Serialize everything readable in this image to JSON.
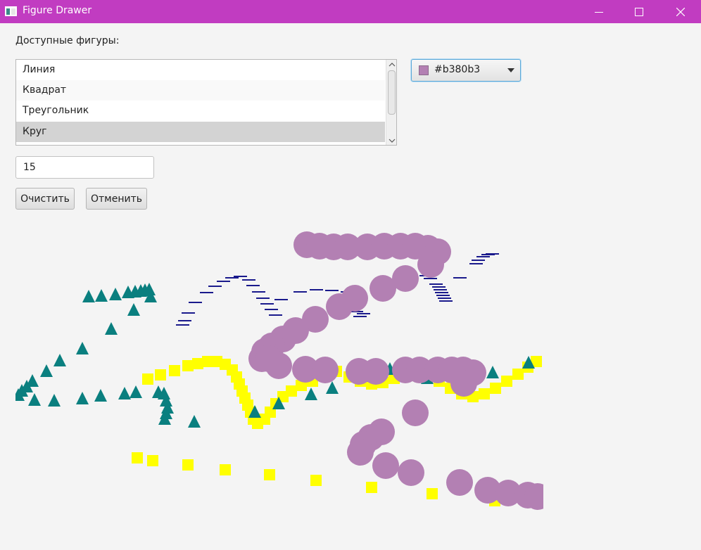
{
  "window": {
    "title": "Figure Drawer",
    "icons": {
      "app": "app-icon",
      "minimize": "minimize-icon",
      "maximize": "maximize-icon",
      "close": "close-icon"
    }
  },
  "controls": {
    "shapes_label": "Доступные фигуры:",
    "shapes": [
      {
        "label": "Линия",
        "selected": false
      },
      {
        "label": "Квадрат",
        "selected": false
      },
      {
        "label": "Треугольник",
        "selected": false
      },
      {
        "label": "Круг",
        "selected": true
      }
    ],
    "color": {
      "value": "#b380b3",
      "icon": "chevron-down-icon"
    },
    "size_value": "15",
    "clear_label": "Очистить",
    "undo_label": "Отменить"
  },
  "colors": {
    "titlebar": "#c13cc1",
    "line": "#1a1a8c",
    "square": "#ffff00",
    "triangle": "#0a7f7f",
    "circle": "#b380b3"
  }
}
